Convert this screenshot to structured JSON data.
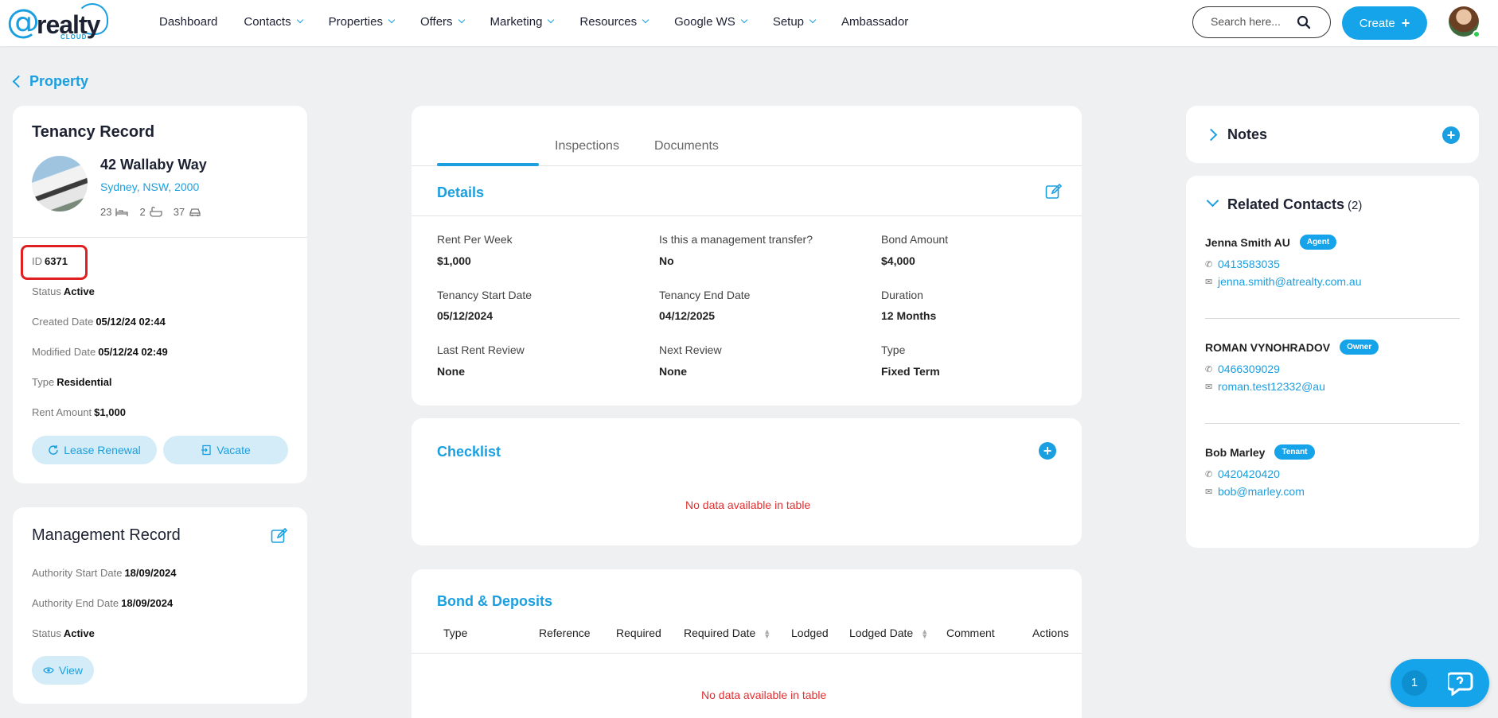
{
  "header": {
    "logo_text": "realty",
    "logo_sub": "CLOUD",
    "nav": [
      {
        "label": "Dashboard",
        "dropdown": false
      },
      {
        "label": "Contacts",
        "dropdown": true
      },
      {
        "label": "Properties",
        "dropdown": true
      },
      {
        "label": "Offers",
        "dropdown": true
      },
      {
        "label": "Marketing",
        "dropdown": true
      },
      {
        "label": "Resources",
        "dropdown": true
      },
      {
        "label": "Google WS",
        "dropdown": true
      },
      {
        "label": "Setup",
        "dropdown": true
      },
      {
        "label": "Ambassador",
        "dropdown": false
      }
    ],
    "search_placeholder": "Search here...",
    "create_label": "Create"
  },
  "breadcrumb": {
    "back_label": "Property"
  },
  "tenancy": {
    "title": "Tenancy Record",
    "address": "42 Wallaby Way",
    "suburb": "Sydney, NSW, 2000",
    "beds": "23",
    "baths": "2",
    "cars": "37",
    "id_label": "ID",
    "id_value": "6371",
    "status_label": "Status",
    "status_value": "Active",
    "created_label": "Created Date",
    "created_value": "05/12/24 02:44",
    "modified_label": "Modified Date",
    "modified_value": "05/12/24 02:49",
    "type_label": "Type",
    "type_value": "Residential",
    "rent_label": "Rent Amount",
    "rent_value": "$1,000",
    "lease_renewal_label": "Lease Renewal",
    "vacate_label": "Vacate"
  },
  "management": {
    "title": "Management Record",
    "start_label": "Authority Start Date",
    "start_value": "18/09/2024",
    "end_label": "Authority End Date",
    "end_value": "18/09/2024",
    "status_label": "Status",
    "status_value": "Active",
    "view_label": "View"
  },
  "tabs": {
    "inspections": "Inspections",
    "documents": "Documents"
  },
  "details": {
    "title": "Details",
    "fields": [
      {
        "label": "Rent Per Week",
        "value": "$1,000"
      },
      {
        "label": "Is this a management transfer?",
        "value": "No"
      },
      {
        "label": "Bond Amount",
        "value": "$4,000"
      },
      {
        "label": "Tenancy Start Date",
        "value": "05/12/2024"
      },
      {
        "label": "Tenancy End Date",
        "value": "04/12/2025"
      },
      {
        "label": "Duration",
        "value": "12 Months"
      },
      {
        "label": "Last Rent Review",
        "value": "None"
      },
      {
        "label": "Next Review",
        "value": "None"
      },
      {
        "label": "Type",
        "value": "Fixed Term"
      }
    ]
  },
  "checklist": {
    "title": "Checklist",
    "empty_text": "No data available in table"
  },
  "bond": {
    "title": "Bond & Deposits",
    "columns": [
      "Type",
      "Reference",
      "Required",
      "Required Date",
      "Lodged",
      "Lodged Date",
      "Comment",
      "Actions"
    ],
    "empty_text": "No data available in table"
  },
  "notes": {
    "title": "Notes"
  },
  "related": {
    "title": "Related Contacts",
    "count": "(2)",
    "contacts": [
      {
        "name": "Jenna Smith AU",
        "role": "Agent",
        "phone": "0413583035",
        "email": "jenna.smith@atrealty.com.au"
      },
      {
        "name": "ROMAN VYNOHRADOV",
        "role": "Owner",
        "phone": "0466309029",
        "email": "roman.test12332@au"
      },
      {
        "name": "Bob Marley",
        "role": "Tenant",
        "phone": "0420420420",
        "email": "bob@marley.com"
      }
    ]
  },
  "chat": {
    "count": "1"
  },
  "colors": {
    "accent": "#1a9fe0",
    "active": "#22b14c",
    "error": "#e03030",
    "highlight": "#e02020"
  }
}
